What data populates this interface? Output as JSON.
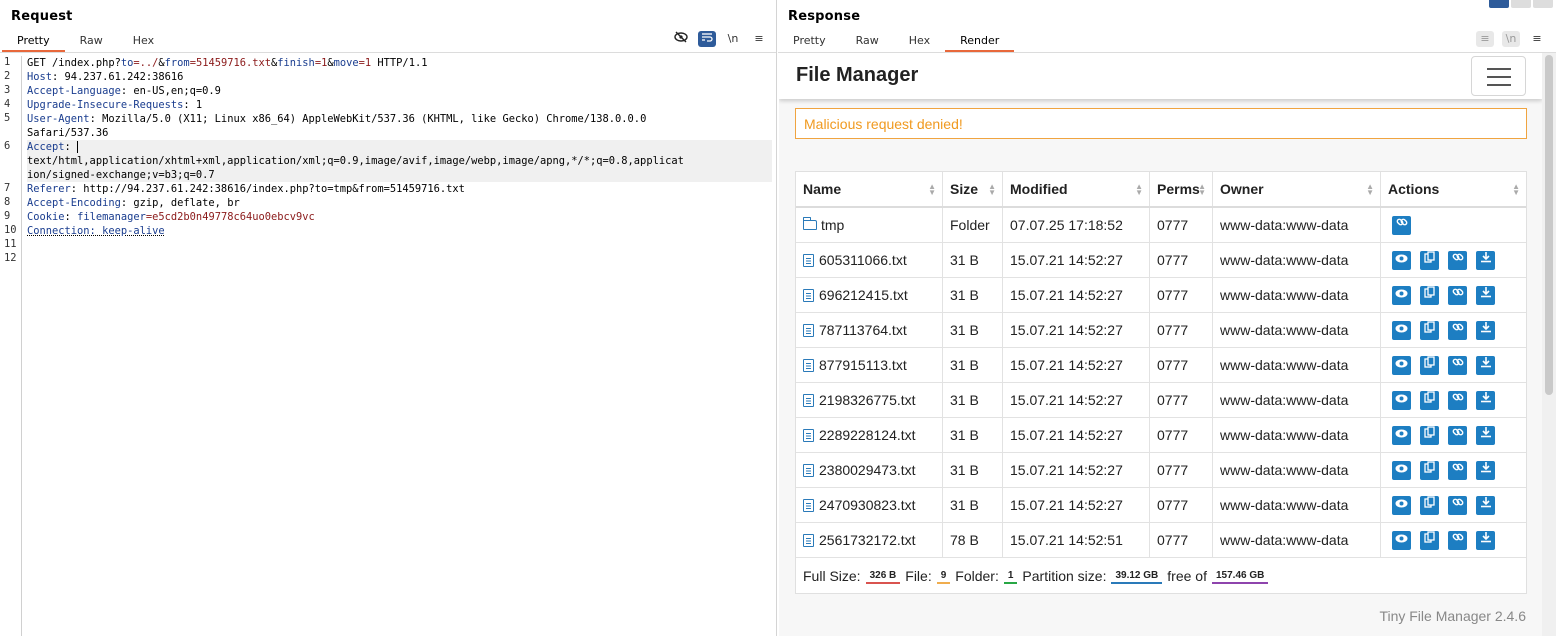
{
  "request": {
    "title": "Request",
    "tabs": [
      "Pretty",
      "Raw",
      "Hex"
    ],
    "tool_icons": [
      "eye-slash-icon",
      "wrap-icon",
      "newline-icon",
      "menu-icon"
    ],
    "lines": [
      "1",
      "2",
      "3",
      "4",
      "5",
      "",
      "6",
      "",
      "",
      "7",
      "8",
      "9",
      "10",
      "11",
      "12"
    ],
    "code": {
      "l1a": "GET /index.php?",
      "l1k1": "to",
      "l1v1": "=../",
      "l1a2": "&",
      "l1k2": "from",
      "l1v2": "=51459716.txt",
      "l1a3": "&",
      "l1k3": "finish",
      "l1v3": "=1",
      "l1a4": "&",
      "l1k4": "move",
      "l1v4": "=1",
      "l1end": " HTTP/1.1",
      "host_k": "Host",
      "host_v": ": 94.237.61.242:38616",
      "al_k": "Accept-Language",
      "al_v": ": en-US,en;q=0.9",
      "uir_k": "Upgrade-Insecure-Requests",
      "uir_v": ": 1",
      "ua_k": "User-Agent",
      "ua_v": ": Mozilla/5.0 (X11; Linux x86_64) AppleWebKit/537.36 (KHTML, like Gecko) Chrome/138.0.0.0",
      "ua_v2": "Safari/537.36",
      "acc_k": "Accept",
      "acc_v": ":",
      "acc_v2": "text/html,application/xhtml+xml,application/xml;q=0.9,image/avif,image/webp,image/apng,*/*;q=0.8,applicat",
      "acc_v3": "ion/signed-exchange;v=b3;q=0.7",
      "ref_k": "Referer",
      "ref_v": ": http://94.237.61.242:38616/index.php?to=tmp&from=51459716.txt",
      "ae_k": "Accept-Encoding",
      "ae_v": ": gzip, deflate, br",
      "ck_k": "Cookie",
      "ck_v": ": ",
      "ck_name": "filemanager",
      "ck_val": "=e5cd2b0n49778c64uo0ebcv9vc",
      "conn": "Connection: keep-alive"
    }
  },
  "response": {
    "title": "Response",
    "tabs": [
      "Pretty",
      "Raw",
      "Hex",
      "Render"
    ],
    "render": {
      "brand": "File Manager",
      "alert": "Malicious request denied!",
      "columns": [
        "Name",
        "Size",
        "Modified",
        "Perms",
        "Owner",
        "Actions"
      ],
      "rows": [
        {
          "name": "tmp",
          "type": "folder",
          "size": "Folder",
          "modified": "07.07.25 17:18:52",
          "perms": "0777",
          "owner": "www-data:www-data"
        },
        {
          "name": "605311066.txt",
          "type": "file",
          "size": "31 B",
          "modified": "15.07.21 14:52:27",
          "perms": "0777",
          "owner": "www-data:www-data"
        },
        {
          "name": "696212415.txt",
          "type": "file",
          "size": "31 B",
          "modified": "15.07.21 14:52:27",
          "perms": "0777",
          "owner": "www-data:www-data"
        },
        {
          "name": "787113764.txt",
          "type": "file",
          "size": "31 B",
          "modified": "15.07.21 14:52:27",
          "perms": "0777",
          "owner": "www-data:www-data"
        },
        {
          "name": "877915113.txt",
          "type": "file",
          "size": "31 B",
          "modified": "15.07.21 14:52:27",
          "perms": "0777",
          "owner": "www-data:www-data"
        },
        {
          "name": "2198326775.txt",
          "type": "file",
          "size": "31 B",
          "modified": "15.07.21 14:52:27",
          "perms": "0777",
          "owner": "www-data:www-data"
        },
        {
          "name": "2289228124.txt",
          "type": "file",
          "size": "31 B",
          "modified": "15.07.21 14:52:27",
          "perms": "0777",
          "owner": "www-data:www-data"
        },
        {
          "name": "2380029473.txt",
          "type": "file",
          "size": "31 B",
          "modified": "15.07.21 14:52:27",
          "perms": "0777",
          "owner": "www-data:www-data"
        },
        {
          "name": "2470930823.txt",
          "type": "file",
          "size": "31 B",
          "modified": "15.07.21 14:52:27",
          "perms": "0777",
          "owner": "www-data:www-data"
        },
        {
          "name": "2561732172.txt",
          "type": "file",
          "size": "78 B",
          "modified": "15.07.21 14:52:51",
          "perms": "0777",
          "owner": "www-data:www-data"
        }
      ],
      "footer": {
        "full_size_label": "Full Size:",
        "full_size": "326 B",
        "file_label": "File:",
        "file_count": "9",
        "folder_label": "Folder:",
        "folder_count": "1",
        "partition_label": "Partition size:",
        "partition": "39.12 GB",
        "free_label": "free of",
        "free": "157.46 GB"
      },
      "version": "Tiny File Manager 2.4.6"
    }
  },
  "colors": {
    "accent_tab": "#e8683b",
    "action_button": "#1d7ec2",
    "alert": "#f09a20"
  }
}
